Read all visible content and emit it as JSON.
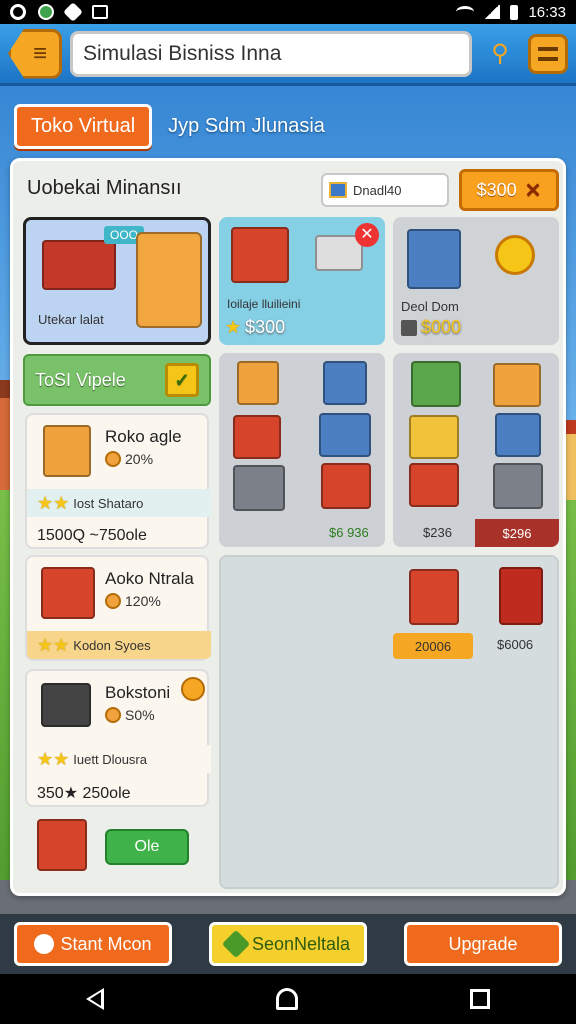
{
  "status_bar": {
    "time": "16:33"
  },
  "header": {
    "title": "Simulasi Bisniss Inna"
  },
  "mode": {
    "button_label": "Toko Virtual",
    "subtitle": "Jyp Sdm Jlunasia"
  },
  "panel": {
    "title": "Uobekai Minansıı",
    "field_value": "Dnadl40",
    "coin_label": "$300"
  },
  "cards": {
    "featured": {
      "badge": "OOO",
      "label": "Utekar lalat"
    },
    "card2": {
      "label": "Ioilaje lluilieini",
      "price": "$300"
    },
    "card3": {
      "label": "Deol Dom",
      "price": "$000"
    },
    "mid_left_price": "$6 936",
    "mid_right_prices": [
      "$236",
      "$296"
    ],
    "bottom_prices": [
      "20006",
      "$6006"
    ]
  },
  "sidebar": {
    "tab_label": "ToSI Vipele"
  },
  "businesses": [
    {
      "name": "Roko agle",
      "pct": "20%",
      "rating_label": "Iost Shataro",
      "footer": "1500Q  ~750ole"
    },
    {
      "name": "Aoko Ntrala",
      "pct": "120%",
      "rating_label": "Kodon Syoes"
    },
    {
      "name": "Bokstoni",
      "pct": "S0%",
      "rating_label": "Iuett Dlousra",
      "footer": "350★  250ole"
    }
  ],
  "action_button": "Ole",
  "bottom_bar": {
    "start": "Stant Mcon",
    "second": "SeonNeltala",
    "upgrade": "Upgrade"
  }
}
